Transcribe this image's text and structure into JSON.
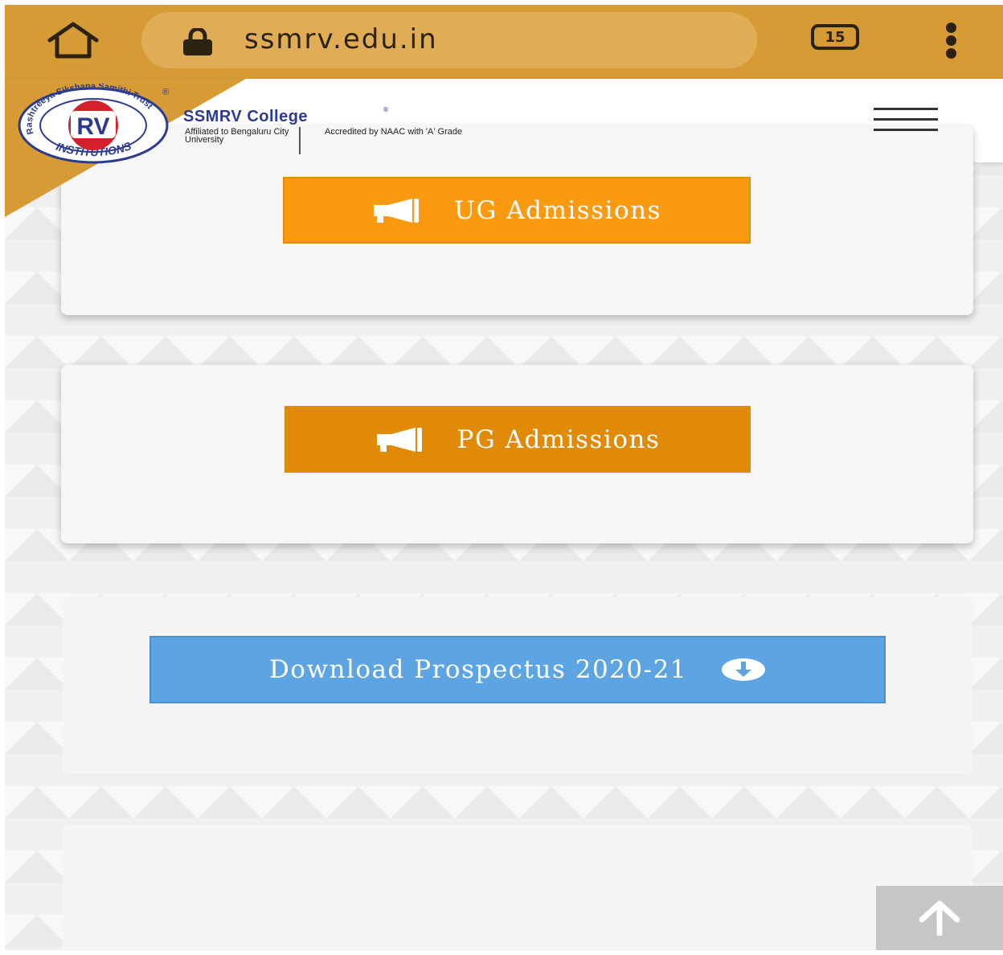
{
  "browser": {
    "url": "ssmrv.edu.in",
    "tab_count": "15",
    "home_icon": "home-icon",
    "lock_icon": "lock-icon",
    "menu_icon": "kebab-menu-icon"
  },
  "header": {
    "college_name": "SSMRV College",
    "registered_mark": "®",
    "affiliation": "Affiliated to Bengaluru City University",
    "accreditation": "Accredited by NAAC with 'A' Grade",
    "logo": {
      "ring_text_top": "Rashtreeya Sikshana Samithi Trust",
      "ring_text_bottom": "INSTITUTIONS",
      "center": "RV",
      "registered_mark": "®"
    },
    "menu_icon": "hamburger-icon"
  },
  "main": {
    "ug_button": "UG Admissions",
    "pg_button": "PG Admissions",
    "prospectus_button": "Download Prospectus 2020-21"
  },
  "colors": {
    "chrome": "#d69b34",
    "ug_orange": "#fa9a10",
    "pg_orange": "#e08a05",
    "download_blue": "#5da4e3",
    "brand_navy": "#2c3b8f",
    "logo_red": "#d4202b"
  },
  "scroll_top_icon": "arrow-up-icon"
}
